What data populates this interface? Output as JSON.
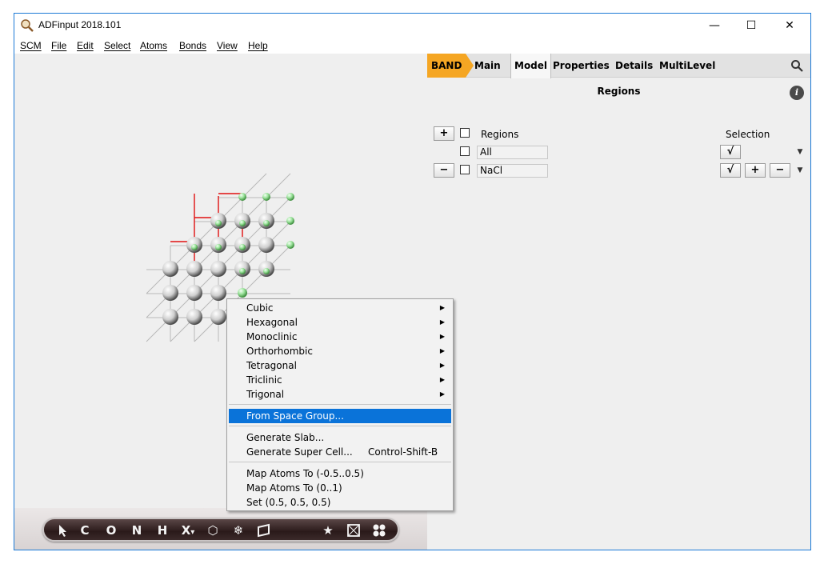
{
  "window": {
    "title": "ADFinput 2018.101",
    "controls": [
      "—",
      "☐",
      "✕"
    ]
  },
  "menubar": [
    "SCM",
    "File",
    "Edit",
    "Select",
    "Atoms",
    "Bonds",
    "View",
    "Help"
  ],
  "tabs": [
    "BAND",
    "Main",
    "Model",
    "Properties",
    "Details",
    "MultiLevel"
  ],
  "panel": {
    "section_title": "Regions",
    "info_glyph": "i",
    "plus_glyph": "+",
    "minus_glyph": "−",
    "check_glyph": "√",
    "dropdown_glyph": "▼",
    "header_regions": "Regions",
    "header_selection": "Selection",
    "rows": [
      {
        "name": "All"
      },
      {
        "name": "NaCl"
      }
    ]
  },
  "context_menu": {
    "group1": [
      {
        "label": "Cubic",
        "submenu": "▶"
      },
      {
        "label": "Hexagonal",
        "submenu": "▶"
      },
      {
        "label": "Monoclinic",
        "submenu": "▶"
      },
      {
        "label": "Orthorhombic",
        "submenu": "▶"
      },
      {
        "label": "Tetragonal",
        "submenu": "▶"
      },
      {
        "label": "Triclinic",
        "submenu": "▶"
      },
      {
        "label": "Trigonal",
        "submenu": "▶"
      }
    ],
    "highlighted": "From Space Group...",
    "group2": [
      {
        "label": "Generate Slab...",
        "shortcut": ""
      },
      {
        "label": "Generate Super Cell...",
        "shortcut": "Control-Shift-B"
      }
    ],
    "group3": [
      {
        "label": "Map Atoms To (-0.5..0.5)"
      },
      {
        "label": "Map Atoms To (0..1)"
      },
      {
        "label": "Set (0.5, 0.5, 0.5)"
      }
    ]
  },
  "toolbar": {
    "tools": [
      "C",
      "O",
      "N",
      "H",
      "X"
    ],
    "x_suffix": "▾",
    "hexagon_glyph": "⬡",
    "snowflake_glyph": "❄",
    "star_glyph": "★"
  },
  "colors": {
    "accent_band": "#f5a623",
    "highlight": "#0a73d9",
    "window_border": "#1c7ad6",
    "atom_na": "#e8e8e8",
    "atom_cl": "#9be39b",
    "bond_red": "#e01010"
  }
}
